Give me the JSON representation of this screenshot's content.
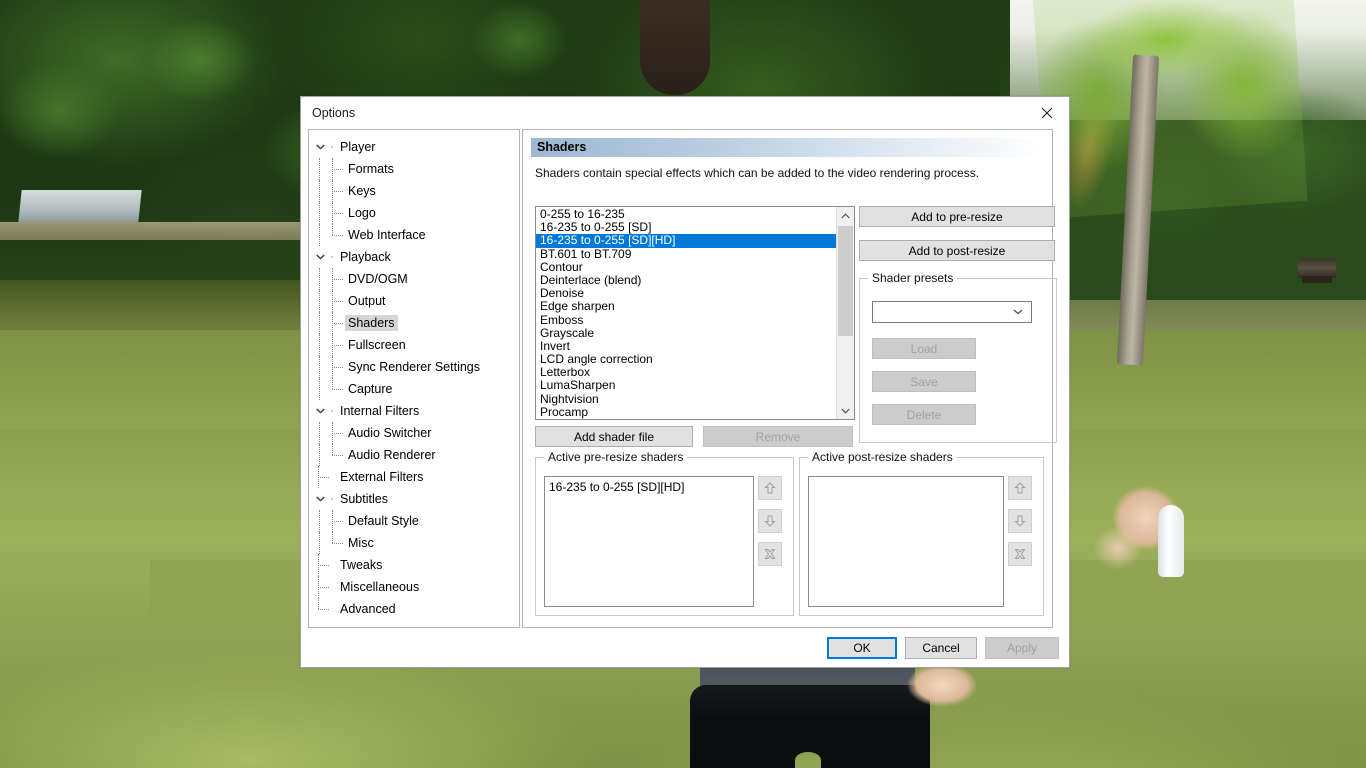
{
  "dialog": {
    "title": "Options",
    "close_icon": "close-icon"
  },
  "tree": {
    "items": [
      {
        "label": "Player",
        "level": 0,
        "expander": "chevron-down",
        "selected": false
      },
      {
        "label": "Formats",
        "level": 1,
        "expander": "none",
        "selected": false
      },
      {
        "label": "Keys",
        "level": 1,
        "expander": "none",
        "selected": false
      },
      {
        "label": "Logo",
        "level": 1,
        "expander": "none",
        "selected": false
      },
      {
        "label": "Web Interface",
        "level": 1,
        "expander": "last",
        "selected": false
      },
      {
        "label": "Playback",
        "level": 0,
        "expander": "chevron-down",
        "selected": false
      },
      {
        "label": "DVD/OGM",
        "level": 1,
        "expander": "none",
        "selected": false
      },
      {
        "label": "Output",
        "level": 1,
        "expander": "none",
        "selected": false
      },
      {
        "label": "Shaders",
        "level": 1,
        "expander": "none",
        "selected": true
      },
      {
        "label": "Fullscreen",
        "level": 1,
        "expander": "none",
        "selected": false
      },
      {
        "label": "Sync Renderer Settings",
        "level": 1,
        "expander": "none",
        "selected": false
      },
      {
        "label": "Capture",
        "level": 1,
        "expander": "last",
        "selected": false
      },
      {
        "label": "Internal Filters",
        "level": 0,
        "expander": "chevron-down",
        "selected": false
      },
      {
        "label": "Audio Switcher",
        "level": 1,
        "expander": "none",
        "selected": false
      },
      {
        "label": "Audio Renderer",
        "level": 1,
        "expander": "last",
        "selected": false
      },
      {
        "label": "External Filters",
        "level": 0,
        "expander": "dot",
        "selected": false
      },
      {
        "label": "Subtitles",
        "level": 0,
        "expander": "chevron-down",
        "selected": false
      },
      {
        "label": "Default Style",
        "level": 1,
        "expander": "none",
        "selected": false
      },
      {
        "label": "Misc",
        "level": 1,
        "expander": "last",
        "selected": false
      },
      {
        "label": "Tweaks",
        "level": 0,
        "expander": "dot",
        "selected": false
      },
      {
        "label": "Miscellaneous",
        "level": 0,
        "expander": "dot",
        "selected": false
      },
      {
        "label": "Advanced",
        "level": 0,
        "expander": "dot-last",
        "selected": false
      }
    ]
  },
  "page": {
    "header": "Shaders",
    "description": "Shaders contain special effects which can be added to the video rendering process."
  },
  "shader_list": {
    "items": [
      "0-255 to 16-235",
      "16-235 to 0-255 [SD]",
      "16-235 to 0-255 [SD][HD]",
      "BT.601 to BT.709",
      "Contour",
      "Deinterlace (blend)",
      "Denoise",
      "Edge sharpen",
      "Emboss",
      "Grayscale",
      "Invert",
      "LCD angle correction",
      "Letterbox",
      "LumaSharpen",
      "Nightvision",
      "Procamp"
    ],
    "selected_index": 2,
    "selection_color": "#0078d7",
    "scroll_up_icon": "chevron-up-icon",
    "scroll_down_icon": "chevron-down-icon"
  },
  "actions": {
    "add_to_pre_resize": "Add to pre-resize",
    "add_to_post_resize": "Add to post-resize",
    "add_shader_file": "Add shader file",
    "remove": "Remove",
    "remove_enabled": false
  },
  "shader_presets": {
    "title": "Shader presets",
    "combo_value": "",
    "combo_icon": "chevron-down-icon",
    "load": "Load",
    "save": "Save",
    "delete": "Delete",
    "buttons_enabled": false
  },
  "active_pre_resize": {
    "title": "Active pre-resize shaders",
    "items": [
      "16-235 to 0-255 [SD][HD]"
    ],
    "move_up_icon": "arrow-up-icon",
    "move_down_icon": "arrow-down-icon",
    "delete_icon": "delete-x-icon"
  },
  "active_post_resize": {
    "title": "Active post-resize shaders",
    "items": [],
    "move_up_icon": "arrow-up-icon",
    "move_down_icon": "arrow-down-icon",
    "delete_icon": "delete-x-icon"
  },
  "footer": {
    "ok": "OK",
    "cancel": "Cancel",
    "apply": "Apply",
    "apply_enabled": false,
    "focus_color": "#0078d7"
  }
}
